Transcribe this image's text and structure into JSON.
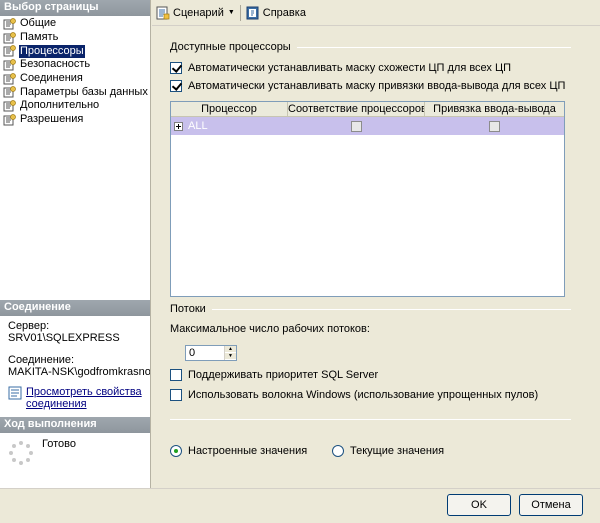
{
  "sidebar": {
    "select_page_header": "Выбор страницы",
    "pages": [
      {
        "label": "Общие",
        "icon": "page-icon"
      },
      {
        "label": "Память",
        "icon": "page-icon"
      },
      {
        "label": "Процессоры",
        "icon": "page-icon",
        "selected": true
      },
      {
        "label": "Безопасность",
        "icon": "page-icon"
      },
      {
        "label": "Соединения",
        "icon": "page-icon"
      },
      {
        "label": "Параметры базы данных",
        "icon": "page-icon"
      },
      {
        "label": "Дополнительно",
        "icon": "page-icon"
      },
      {
        "label": "Разрешения",
        "icon": "page-icon"
      }
    ],
    "connection": {
      "header": "Соединение",
      "server_label": "Сервер:",
      "server_value": "SRV01\\SQLEXPRESS",
      "connection_label": "Соединение:",
      "connection_value": "MAKITA-NSK\\godfromkrasnoyarsl",
      "view_link": "Просмотреть свойства соединения"
    },
    "progress": {
      "header": "Ход выполнения",
      "status": "Готово"
    }
  },
  "toolbar": {
    "script_label": "Сценарий",
    "help_label": "Справка"
  },
  "processors": {
    "group_title": "Доступные процессоры",
    "auto_affinity_label": "Автоматически устанавливать маску схожести ЦП для всех ЦП",
    "auto_affinity_checked": true,
    "auto_io_label": "Автоматически устанавливать маску привязки ввода-вывода для всех ЦП",
    "auto_io_checked": true,
    "grid": {
      "columns": [
        "Процессор",
        "Соответствие процессоров",
        "Привязка ввода-вывода"
      ],
      "rows": [
        {
          "processor": "ALL",
          "affinity": false,
          "io": false
        }
      ]
    }
  },
  "threads": {
    "group_title": "Потоки",
    "max_threads_label": "Максимальное число рабочих потоков:",
    "max_threads_value": "0",
    "boost_label": "Поддерживать приоритет SQL Server",
    "boost_checked": false,
    "fibers_label": "Использовать волокна Windows (использование упрощенных пулов)",
    "fibers_checked": false
  },
  "mode": {
    "configured_label": "Настроенные значения",
    "running_label": "Текущие значения",
    "selected": "configured"
  },
  "footer": {
    "ok_label": "OK",
    "cancel_label": "Отмена"
  }
}
